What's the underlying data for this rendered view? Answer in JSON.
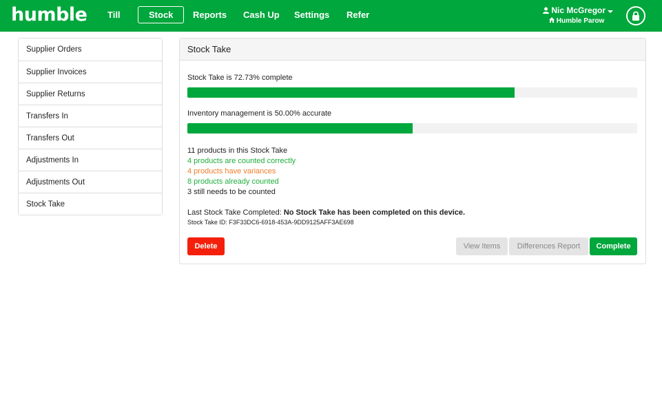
{
  "header": {
    "logo": "humble",
    "nav": [
      {
        "label": "Till"
      },
      {
        "label": "Stock"
      },
      {
        "label": "Reports"
      },
      {
        "label": "Cash Up"
      },
      {
        "label": "Settings"
      },
      {
        "label": "Refer"
      }
    ],
    "active_nav": "Stock",
    "user_name": "Nic McGregor",
    "store_name": "Humble Parow",
    "icons": [
      "user-icon",
      "caret-down-icon",
      "home-icon",
      "lock-icon"
    ]
  },
  "sidebar": {
    "items": [
      {
        "label": "Supplier Orders"
      },
      {
        "label": "Supplier Invoices"
      },
      {
        "label": "Supplier Returns"
      },
      {
        "label": "Transfers In"
      },
      {
        "label": "Transfers Out"
      },
      {
        "label": "Adjustments In"
      },
      {
        "label": "Adjustments Out"
      },
      {
        "label": "Stock Take"
      }
    ]
  },
  "panel": {
    "title": "Stock Take",
    "progress_text": "Stock Take is 72.73% complete",
    "progress_percent": 72.73,
    "accuracy_text": "Inventory management is 50.00% accurate",
    "accuracy_percent": 50.0,
    "stats": {
      "total": "11 products in this Stock Take",
      "correct": "4 products are counted correctly",
      "variances": "4 products have variances",
      "counted": "8 products already counted",
      "remaining": "3 still needs to be counted"
    },
    "last_completed_label": "Last Stock Take Completed:",
    "last_completed_value": "No Stock Take has been completed on this device.",
    "stock_take_id": "Stock Take ID: F3F33DC6-6918-453A-9DD9125AFF3AE698",
    "buttons": {
      "delete": "Delete",
      "view_items": "View Items",
      "differences_report": "Differences Report",
      "complete": "Complete"
    }
  },
  "colors": {
    "brand_green": "#00a73c",
    "text_green": "#1fad3d",
    "text_orange": "#f07b2a",
    "delete_red": "#f4200c"
  }
}
